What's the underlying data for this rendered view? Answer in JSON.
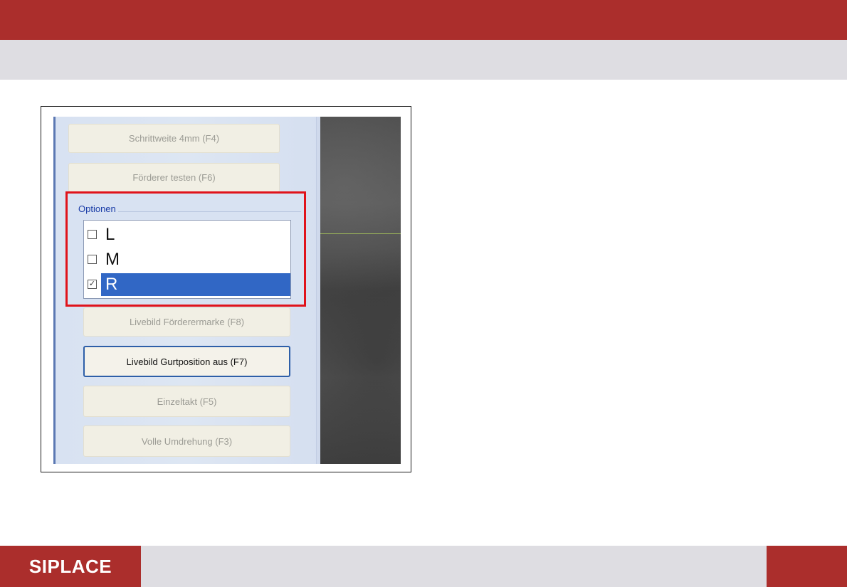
{
  "footer": {
    "logo_text": "SIPLACE"
  },
  "panel": {
    "buttons": [
      {
        "label": "Schrittweite 4mm (F4)",
        "enabled": false
      },
      {
        "label": "Förderer testen (F6)",
        "enabled": false
      },
      {
        "label": "Livebild Förderermarke (F8)",
        "enabled": false
      },
      {
        "label": "Livebild Gurtposition aus (F7)",
        "enabled": true
      },
      {
        "label": "Einzeltakt (F5)",
        "enabled": false
      },
      {
        "label": "Volle Umdrehung (F3)",
        "enabled": false
      }
    ],
    "options": {
      "group_label": "Optionen",
      "items": [
        {
          "label": "L",
          "checked": false,
          "selected": false
        },
        {
          "label": "M",
          "checked": false,
          "selected": false
        },
        {
          "label": "R",
          "checked": true,
          "selected": true
        }
      ]
    },
    "highlight_color": "#e0131b",
    "selection_color": "#3167c5"
  },
  "colors": {
    "brand_red": "#ab2e2c",
    "band_gray": "#dedde2"
  }
}
